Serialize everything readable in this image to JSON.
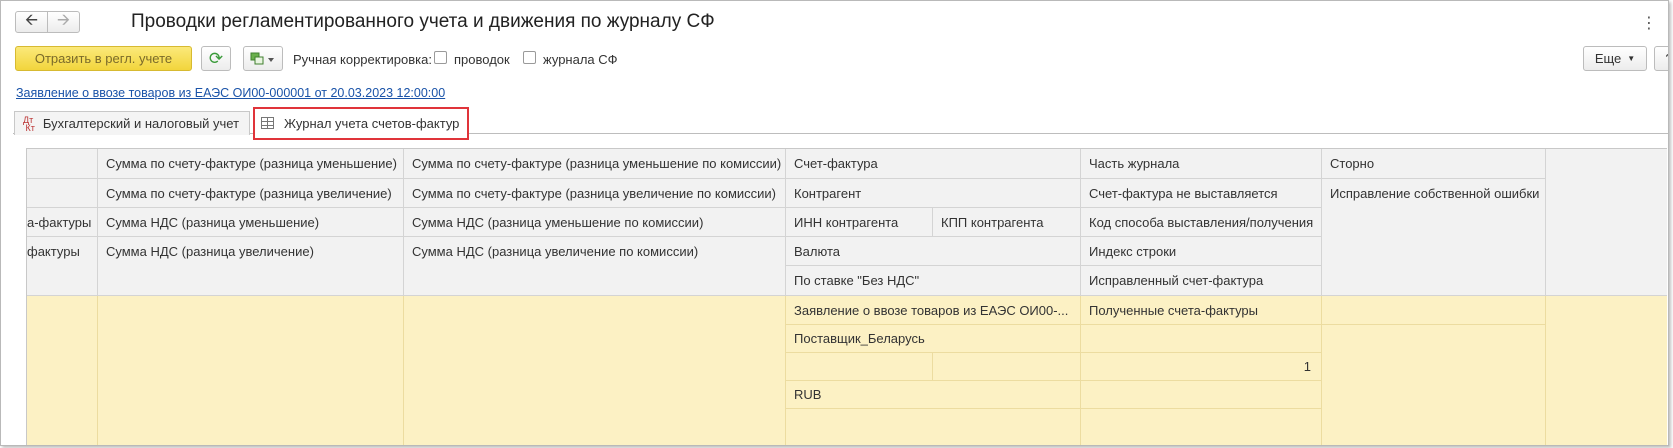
{
  "window": {
    "title": "Проводки регламентированного учета и движения по журналу СФ",
    "back_icon": "arrow-left-icon",
    "forward_icon": "arrow-right-icon",
    "menu_icon": "vertical-ellipsis-icon"
  },
  "toolbar": {
    "post_label": "Отразить в регл. учете",
    "refresh_icon": "refresh-icon",
    "report_icon": "report-structure-icon",
    "manual_label": "Ручная корректировка:",
    "check_postings_label": "проводок",
    "check_postings_checked": false,
    "check_journal_label": "журнала СФ",
    "check_journal_checked": false,
    "more_label": "Еще",
    "help_label": "?"
  },
  "document_link": "Заявление о ввозе товаров из ЕАЭС ОИ00-000001 от 20.03.2023 12:00:00",
  "tabs": [
    {
      "label": "Бухгалтерский и налоговый учет",
      "icon": "dt-kt-icon",
      "active": false
    },
    {
      "label": "Журнал учета счетов-фактур",
      "icon": "table-icon",
      "active": true
    }
  ],
  "colors": {
    "highlight": "#e0343a",
    "row_fill": "#fcf1c4",
    "primary_button": "#f2d53c"
  },
  "table": {
    "col0": [
      "",
      "",
      "а-фактуры",
      "фактуры",
      ""
    ],
    "col1": [
      "Сумма по счету-фактуре (разница уменьшение)",
      "Сумма по счету-фактуре (разница увеличение)",
      "Сумма НДС (разница уменьшение)",
      "Сумма НДС (разница увеличение)"
    ],
    "col2": [
      "Сумма по счету-фактуре (разница уменьшение по комиссии)",
      "Сумма по счету-фактуре (разница увеличение по комиссии)",
      "Сумма НДС (разница уменьшение по комиссии)",
      "Сумма НДС (разница увеличение по комиссии)"
    ],
    "col3": {
      "invoice": "Счет-фактура",
      "counterparty": "Контрагент",
      "inn": "ИНН контрагента",
      "kpp": "КПП контрагента",
      "currency": "Валюта",
      "rate": "По ставке \"Без НДС\""
    },
    "col4": [
      "Часть журнала",
      "Счет-фактура не выставляется",
      "Код способа выставления/получения",
      "Индекс строки",
      "Исправленный счет-фактура"
    ],
    "col5": [
      "Сторно",
      "Исправление собственной ошибки"
    ],
    "row": {
      "invoice": "Заявление о ввозе товаров из ЕАЭС ОИ00-...",
      "counterparty": "Поставщик_Беларусь",
      "currency": "RUB",
      "journal_part": "Полученные счета-фактуры",
      "row_index": "1"
    }
  }
}
